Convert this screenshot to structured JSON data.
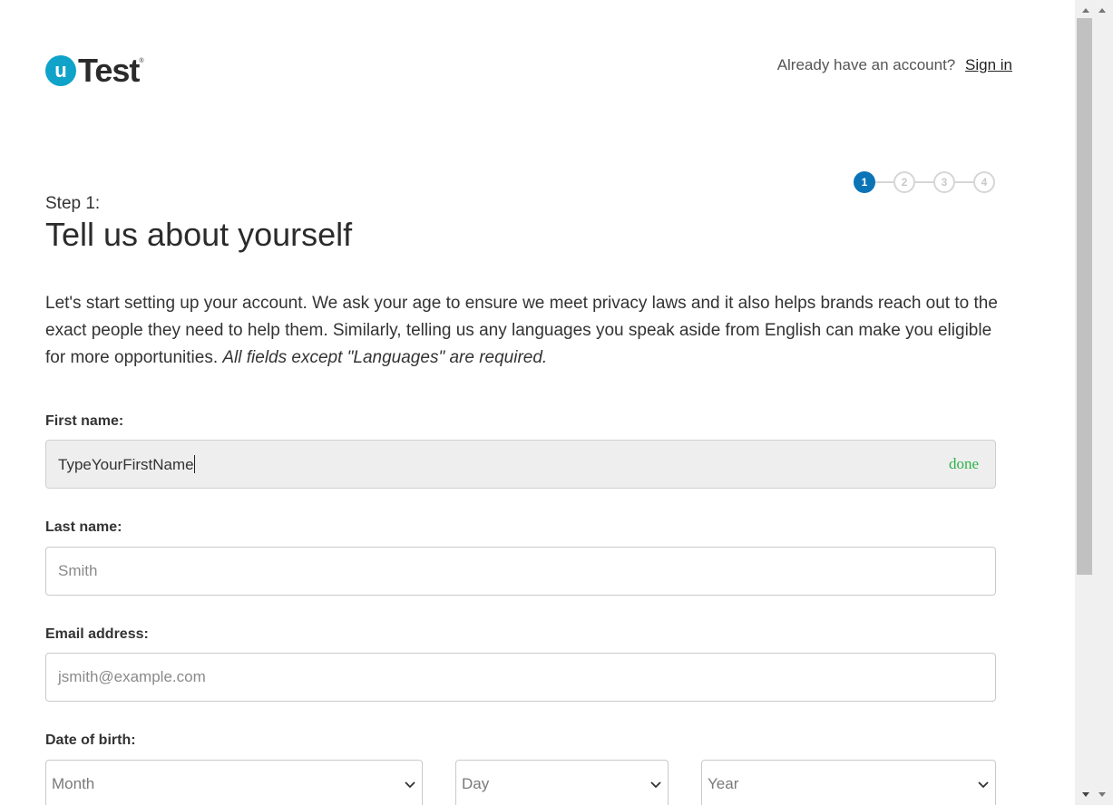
{
  "header": {
    "logo_letter": "u",
    "logo_text": "Test",
    "logo_reg": "®",
    "account_prompt": "Already have an account?",
    "sign_in_label": "Sign in"
  },
  "stepper": {
    "steps": [
      "1",
      "2",
      "3",
      "4"
    ],
    "active_step": 1
  },
  "step_label": "Step 1:",
  "page_title": "Tell us about yourself",
  "intro": {
    "text": "Let's start setting up your account. We ask your age to ensure we meet privacy laws and it also helps brands reach out to the exact people they need to help them. Similarly, telling us any languages you speak aside from English can make you eligible for more opportunities. ",
    "emphasis": "All fields except \"Languages\" are required."
  },
  "form": {
    "first_name": {
      "label": "First name:",
      "value": "TypeYourFirstName",
      "status": "done"
    },
    "last_name": {
      "label": "Last name:",
      "placeholder": "Smith"
    },
    "email": {
      "label": "Email address:",
      "placeholder": "jsmith@example.com"
    },
    "dob": {
      "label": "Date of birth:",
      "month": "Month",
      "day": "Day",
      "year": "Year"
    }
  },
  "colors": {
    "brand": "#0fa3c9",
    "active_step": "#0a74b7",
    "done": "#2db34a"
  },
  "icons": {
    "select_chevron": "chevron-down-icon",
    "scroll_up": "scroll-up-arrow-icon",
    "scroll_down": "scroll-down-arrow-icon"
  }
}
